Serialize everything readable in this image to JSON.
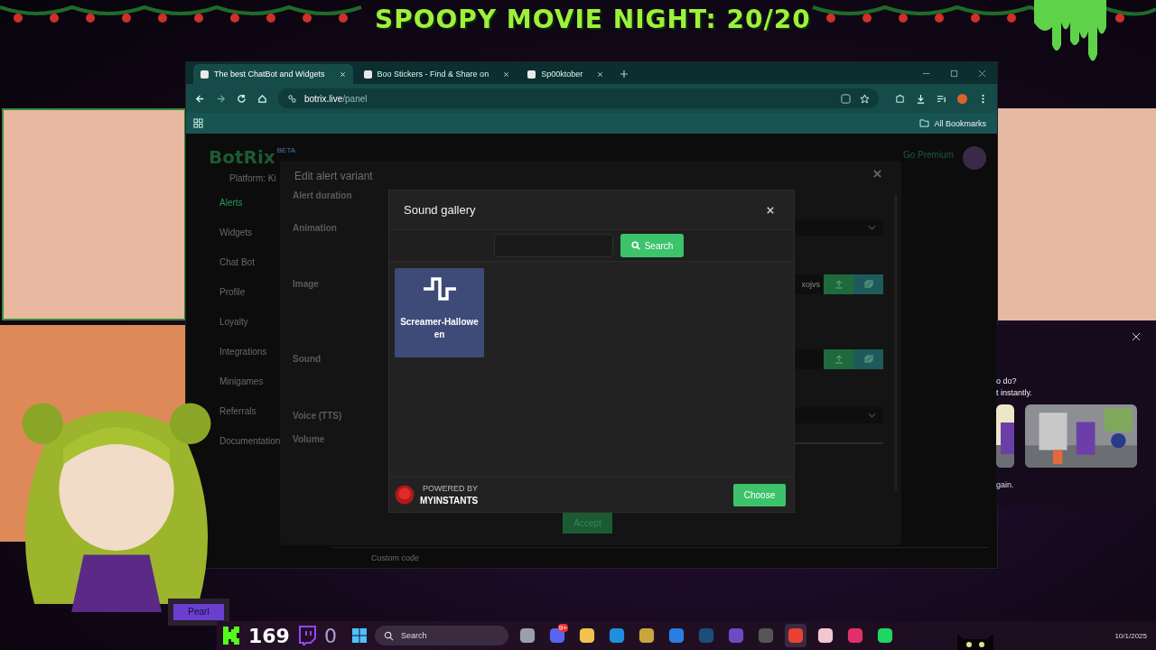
{
  "banner": {
    "title": "SPOOPY MOVIE NIGHT: 20/20"
  },
  "browser": {
    "tabs": [
      {
        "title": "The best ChatBot and Widgets",
        "selected": true
      },
      {
        "title": "Boo Stickers - Find & Share on",
        "selected": false
      },
      {
        "title": "Sp00ktober",
        "selected": false
      }
    ],
    "address": {
      "host": "botrix.live",
      "path": "/panel"
    },
    "bookmarks_label": "All Bookmarks"
  },
  "page": {
    "logo": "BotRix",
    "logo_badge": "BETA",
    "platform": "Platform: Ki",
    "premium": "Go Premium",
    "sidebar": [
      {
        "label": "Alerts",
        "selected": true
      },
      {
        "label": "Widgets",
        "selected": false
      },
      {
        "label": "Chat Bot",
        "selected": false
      },
      {
        "label": "Profile",
        "selected": false
      },
      {
        "label": "Loyalty",
        "selected": false
      },
      {
        "label": "Integrations",
        "selected": false
      },
      {
        "label": "Minigames",
        "selected": false
      },
      {
        "label": "Referrals",
        "selected": false
      },
      {
        "label": "Documentation",
        "selected": false
      }
    ],
    "custom_code": "Custom code"
  },
  "edit_modal": {
    "title": "Edit alert variant",
    "fields": [
      {
        "label": "Alert duration",
        "kind": "none"
      },
      {
        "label": "Animation",
        "kind": "select"
      },
      {
        "label": "Image",
        "kind": "file"
      },
      {
        "label": "Sound",
        "kind": "file"
      },
      {
        "label": "Voice (TTS)",
        "kind": "select"
      },
      {
        "label": "Volume",
        "kind": "none"
      }
    ],
    "image_file": "xojvs",
    "accept": "Accept"
  },
  "sound_gallery": {
    "title": "Sound gallery",
    "search_button": "Search",
    "sounds": [
      {
        "name": "Screamer-Halloween",
        "selected": true
      }
    ],
    "powered_by": "POWERED BY",
    "provider": "MYINSTANTS",
    "choose": "Choose"
  },
  "popup": {
    "lines": [
      "o do?",
      "t instantly."
    ],
    "footer": "gain.",
    "pictures": [
      {
        "kind": "picture"
      },
      {
        "kind": "picture"
      }
    ]
  },
  "nameplate": "Pearl",
  "counters": [
    {
      "kind": "kick",
      "value": "169"
    },
    {
      "kind": "twitch",
      "value": "0"
    }
  ],
  "taskbar": {
    "search_placeholder": "Search",
    "apps": [
      {
        "color": "#9aa0aa",
        "selected": false
      },
      {
        "color": "#5865f2",
        "selected": false,
        "badge": "9+"
      },
      {
        "color": "#f2c14e",
        "selected": false
      },
      {
        "color": "#1f8fe0",
        "selected": false
      },
      {
        "color": "#c9a53c",
        "selected": false
      },
      {
        "color": "#2a7de1",
        "selected": false
      },
      {
        "color": "#1b4f7a",
        "selected": false
      },
      {
        "color": "#6a4bc4",
        "selected": false
      },
      {
        "color": "#555555",
        "selected": false
      },
      {
        "color": "#e94235",
        "selected": true
      },
      {
        "color": "#f3c6d0",
        "selected": false
      },
      {
        "color": "#e0306a",
        "selected": false
      },
      {
        "color": "#1ed760",
        "selected": false
      }
    ],
    "date": "10/1/2025"
  }
}
